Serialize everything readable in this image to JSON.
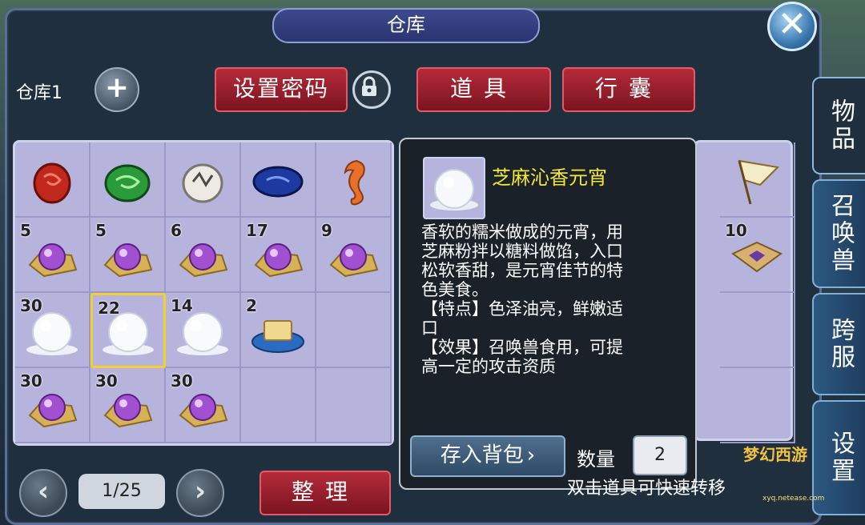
{
  "window": {
    "title": "仓库",
    "close_label": "✕"
  },
  "side_tabs": [
    {
      "label": "物品",
      "active": true
    },
    {
      "label": "召唤兽",
      "active": false
    },
    {
      "label": "跨服",
      "active": false
    },
    {
      "label": "设置",
      "active": false
    }
  ],
  "toolbar": {
    "warehouse_label": "仓库1",
    "add_label": "+",
    "set_password_label": "设置密码",
    "items_tab_label": "道具",
    "bag_tab_label": "行囊"
  },
  "grid": {
    "cells": [
      {
        "count": "",
        "item": "red-jade-disc"
      },
      {
        "count": "",
        "item": "green-jade-disc"
      },
      {
        "count": "",
        "item": "white-jade-disc"
      },
      {
        "count": "",
        "item": "blue-stone"
      },
      {
        "count": "",
        "item": "seahorse"
      },
      {
        "count": "5",
        "item": "purple-tangyuan"
      },
      {
        "count": "5",
        "item": "purple-tangyuan"
      },
      {
        "count": "6",
        "item": "purple-tangyuan"
      },
      {
        "count": "17",
        "item": "purple-tangyuan"
      },
      {
        "count": "9",
        "item": "purple-tangyuan"
      },
      {
        "count": "30",
        "item": "white-tangyuan"
      },
      {
        "count": "22",
        "item": "white-tangyuan",
        "selected": true
      },
      {
        "count": "14",
        "item": "white-tangyuan"
      },
      {
        "count": "2",
        "item": "tofu-dish"
      },
      {
        "count": "",
        "item": ""
      },
      {
        "count": "30",
        "item": "purple-tangyuan"
      },
      {
        "count": "30",
        "item": "purple-tangyuan"
      },
      {
        "count": "30",
        "item": "purple-tangyuan"
      },
      {
        "count": "",
        "item": ""
      },
      {
        "count": "",
        "item": ""
      }
    ],
    "right_column": [
      {
        "count": "",
        "item": "flag"
      },
      {
        "count": "10",
        "item": "ornate-box"
      },
      {
        "count": "",
        "item": ""
      },
      {
        "count": "",
        "item": ""
      }
    ]
  },
  "tooltip": {
    "name": "芝麻沁香元宵",
    "description": "香软的糯米做成的元宵，用\n芝麻粉拌以糖料做馅，入口\n松软香甜，是元宵佳节的特\n色美食。\n【特点】色泽油亮，鲜嫩适\n口\n【效果】召唤兽食用，可提\n高一定的攻击资质",
    "store_button_label": "存入背包",
    "quantity_label": "数量",
    "quantity_value": "2"
  },
  "footer": {
    "prev_label": "‹",
    "next_label": "›",
    "page_indicator": "1/25",
    "sort_label": "整理",
    "hint": "双击道具可快速转移"
  },
  "watermark": {
    "text": "梦幻西游",
    "sub": "xyq.netease.com"
  }
}
